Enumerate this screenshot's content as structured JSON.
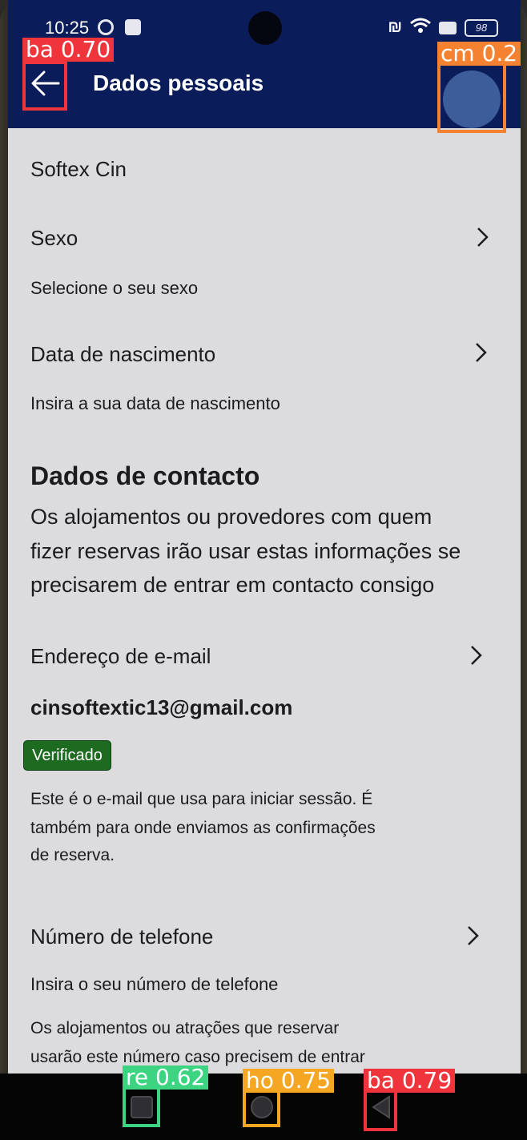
{
  "status": {
    "time": "10:25",
    "battery": "98"
  },
  "header": {
    "title": "Dados pessoais"
  },
  "profile": {
    "name": "Softex Cin"
  },
  "gender": {
    "label": "Sexo",
    "hint": "Selecione o seu sexo"
  },
  "birth": {
    "label": "Data de nascimento",
    "hint": "Insira a sua data de nascimento"
  },
  "contact": {
    "heading": "Dados de contacto",
    "desc_lines": [
      "Os alojamentos ou provedores com quem",
      "fizer reservas irão usar estas informações se",
      "precisarem de entrar em contacto consigo"
    ]
  },
  "email": {
    "label": "Endereço de e-mail",
    "value": "cinsoftextic13@gmail.com",
    "badge": "Verificado",
    "desc_lines": [
      "Este é o e-mail que usa para iniciar sessão. É",
      "também para onde enviamos as confirmações",
      "de reserva."
    ]
  },
  "phone": {
    "label": "Número de telefone",
    "hint": "Insira o seu número de telefone",
    "desc_lines": [
      "Os alojamentos ou atrações que reservar",
      "usarão este número caso precisem de entrar"
    ]
  },
  "detections": {
    "back_top": {
      "label": "ba 0.70",
      "color": "#f0343c"
    },
    "camera": {
      "label": "cm 0.2",
      "color": "#f58231"
    },
    "recent": {
      "label": "re 0.62",
      "color": "#3cd480"
    },
    "home": {
      "label": "ho 0.75",
      "color": "#f5a623"
    },
    "back_nav": {
      "label": "ba 0.79",
      "color": "#f0343c"
    }
  },
  "icons": {
    "back": "arrow-left-icon",
    "chevron": "chevron-right-icon",
    "nav_recent": "square-icon",
    "nav_home": "circle-icon",
    "nav_back": "triangle-left-icon"
  }
}
